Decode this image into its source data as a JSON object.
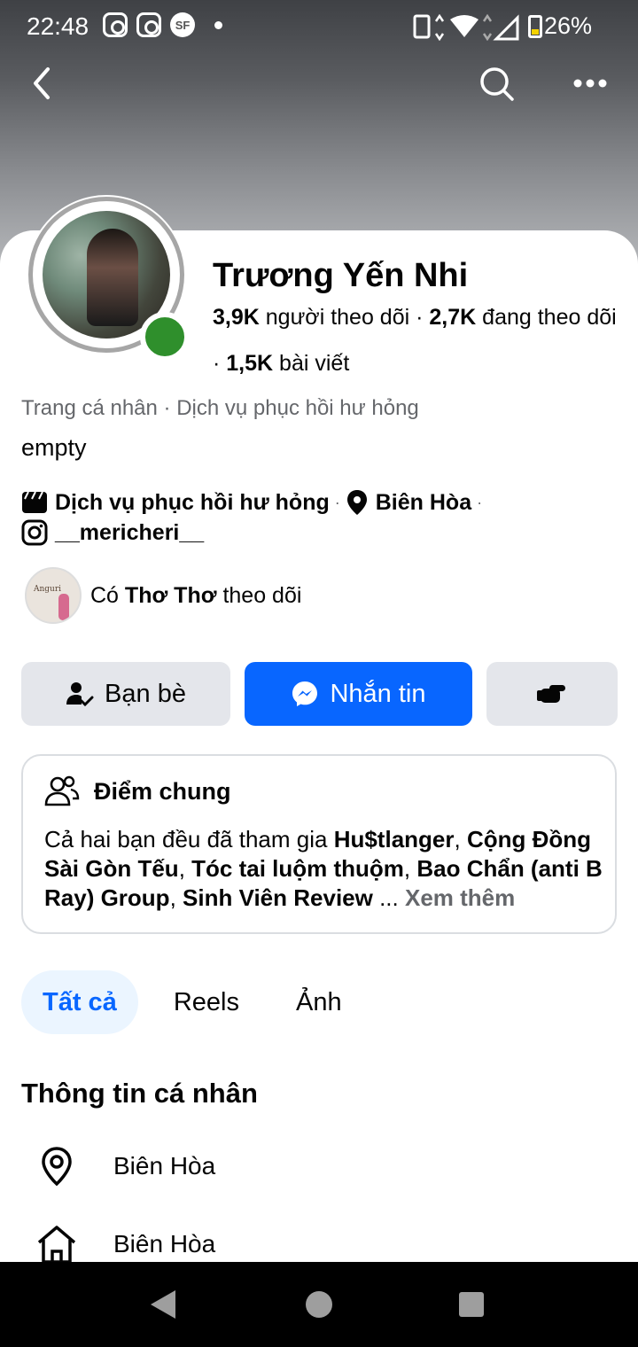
{
  "status_bar": {
    "time": "22:48",
    "battery": "26%"
  },
  "profile": {
    "name": "Trương Yến Nhi",
    "followers_count": "3,9K",
    "followers_label": "người theo dõi",
    "following_count": "2,7K",
    "following_label": "đang theo dõi",
    "posts_count": "1,5K",
    "posts_label": "bài viết",
    "category": "Trang cá nhân · Dịch vụ phục hồi hư hỏng",
    "bio": "empty"
  },
  "details": {
    "service": "Dịch vụ phục hồi hư hỏng",
    "location": "Biên Hòa",
    "instagram": "__mericheri__"
  },
  "followed_by": {
    "prefix": "Có",
    "name": "Thơ Thơ",
    "suffix": "theo dõi",
    "avatar_text": "Anguri"
  },
  "actions": {
    "friends_label": "Bạn bè",
    "message_label": "Nhắn tin"
  },
  "mutual": {
    "title": "Điểm chung",
    "text_prefix": "Cả hai bạn đều đã tham gia",
    "groups": [
      "Hu$tlanger",
      "Cộng Đồng Sài Gòn Tếu",
      "Tóc tai luộm thuộm",
      "Bao Chẩn (anti B Ray) Group",
      "Sinh Viên Review"
    ],
    "see_more": "Xem thêm"
  },
  "tabs": [
    {
      "label": "Tất cả",
      "active": true
    },
    {
      "label": "Reels",
      "active": false
    },
    {
      "label": "Ảnh",
      "active": false
    }
  ],
  "personal_info": {
    "title": "Thông tin cá nhân",
    "items": [
      {
        "icon": "location-pin-icon",
        "text": "Biên Hòa"
      },
      {
        "icon": "home-icon",
        "text": "Biên Hòa"
      }
    ]
  },
  "colors": {
    "brand_blue": "#0866ff",
    "online_green": "#2f8f2c",
    "button_gray": "#e4e6eb",
    "secondary_text": "#65676b"
  }
}
